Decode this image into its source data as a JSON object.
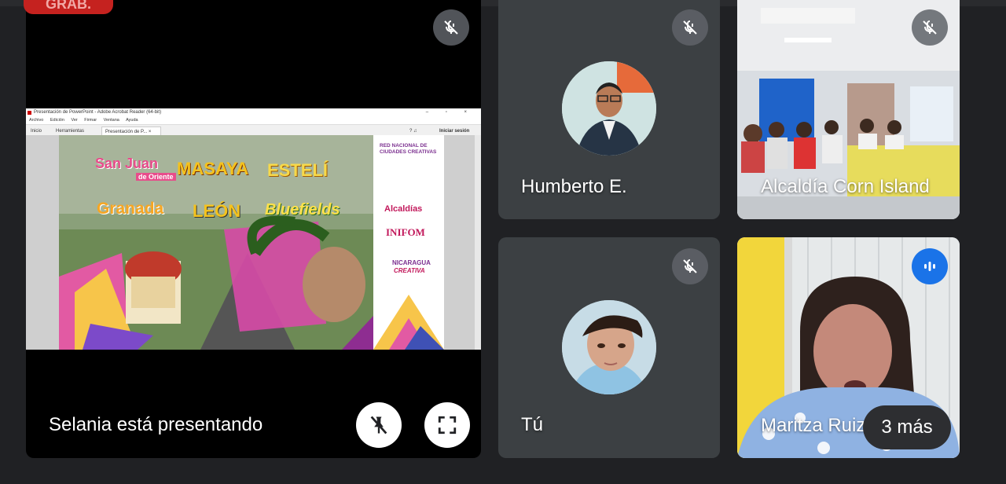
{
  "recording_badge": "GRAB.",
  "presenter_tile": {
    "label": "Selania está presentando",
    "acrobat": {
      "window_title": "Presentación de PowerPoint - Adobe Acrobat Reader (64-bit)",
      "menu": [
        "Archivo",
        "Edición",
        "Ver",
        "Firmar",
        "Ventana",
        "Ayuda"
      ],
      "tabs": [
        "Inicio",
        "Herramientas",
        "Presentación de P..."
      ],
      "signin": "Iniciar sesión"
    },
    "slide": {
      "cities": [
        "San Juan",
        "de Oriente",
        "MASAYA",
        "ESTELÍ",
        "Granada",
        "LEÓN",
        "Bluefields"
      ],
      "sidebar": [
        "RED NACIONAL DE",
        "CIUDADES CREATIVAS",
        "Alcaldías",
        "INIFOM",
        "NICARAGUA",
        "CREATIVA"
      ]
    }
  },
  "participants": [
    {
      "name": "Humberto E.",
      "muted": true
    },
    {
      "name": "Alcaldía Corn Island",
      "muted": true
    },
    {
      "name": "Tú",
      "muted": true
    },
    {
      "name": "Maritza Ruiz",
      "speaking": true
    }
  ],
  "more_participants": "3 más",
  "colors": {
    "background": "#202124",
    "tile": "#3c4043",
    "speaking": "#1a73e8",
    "record": "#c5221f"
  },
  "icons": [
    "mic-off-icon",
    "pin-off-icon",
    "fullscreen-icon",
    "audio-wave-icon"
  ]
}
